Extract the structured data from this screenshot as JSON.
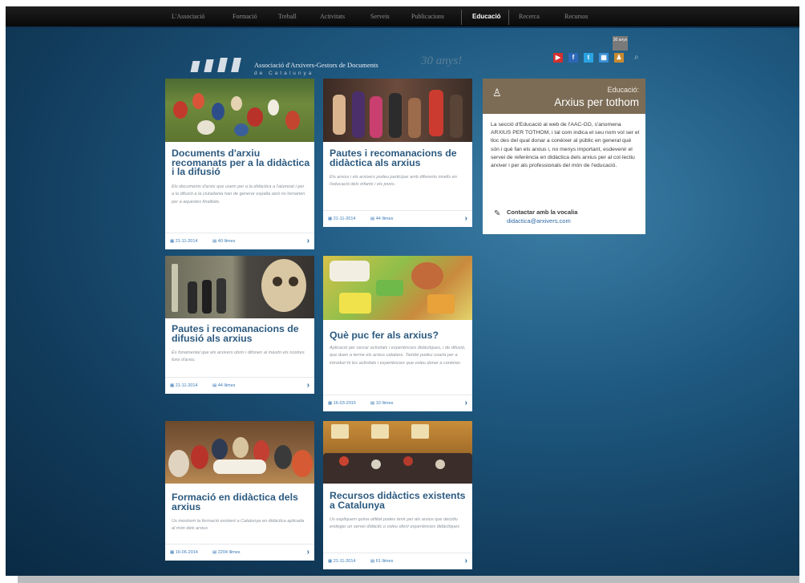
{
  "nav": {
    "items": [
      "L'Associació",
      "Formació",
      "Treball",
      "Activitats",
      "Serveis",
      "Publicacions",
      "Educació",
      "Recerca",
      "Recursos"
    ],
    "active": "Educació"
  },
  "header": {
    "org_name": "Associació d'Arxivers-Gestors de Documents",
    "org_region": "de Catalunya",
    "anniversary": "30 anys!",
    "badge": "30 anys"
  },
  "social": {
    "icons": [
      "youtube-icon",
      "facebook-icon",
      "twitter-icon",
      "calendar-icon",
      "user-icon",
      "search-icon"
    ],
    "colors": {
      "youtube": "#d32f2f",
      "facebook": "#2d68b8",
      "twitter": "#2aa3e0",
      "calendar": "#3a8fd6",
      "user": "#c88a2e"
    }
  },
  "cards": [
    {
      "title": "Documents d'arxiu recomanats per a la didàctica i la difusió",
      "desc": "Els documents d'arxiu que usem per a la didàctica a l'alumnat i per a la difusió a la ciutadania han de generar espalla això no tornarien per a aquestes finalitats.",
      "date": "21-11-2014",
      "reads": "40 llimes"
    },
    {
      "title": "Pautes i recomanacions de didàctica als arxius",
      "desc": "Els arxius i els arxivers podeu participar amb diferents nivells en l'educació dels infants i els joves.",
      "date": "21-11-2014",
      "reads": "44 llimes"
    },
    {
      "title": "Pautes i recomanacions de difusió als arxius",
      "desc": "És fonamental que els arxivers obrin i difonen al màxim els nostres fons d'arxiu.",
      "date": "21-11-2014",
      "reads": "44 llimes"
    },
    {
      "title": "Què puc fer als arxius?",
      "desc": "Aplicació per cercar activitats i experiències didàctiques, i de difusió, que duen a terme els arxius catalans. També podeu usarla per a introduir-hi les activitats i experiències que voleu donar a conèixer.",
      "date": "16-03-2015",
      "reads": "10 llimes"
    },
    {
      "title": "Formació en didàctica dels arxius",
      "desc": "Us mostrem la formació existent a Catalunya en didàctica aplicada al món dels arxius",
      "date": "16-06-2014",
      "reads": "2204 llimes"
    },
    {
      "title": "Recursos didàctics existents a Catalunya",
      "desc": "Us expliquem quina utilitat podeu tenir per als arxius que decidiu endegar un servei didàctic o voleu oferir experiències didàctiques",
      "date": "21-11-2014",
      "reads": "61 llimes"
    }
  ],
  "sidebar": {
    "kicker": "Educació:",
    "headline": "Arxius per tothom",
    "body": "La secció d'Educació al web de l'AAC-GD, s'anomena ARXIUS PER TOTHOM, i tal com indica el seu nom vol ser el lloc des del qual donar a conèixer al públic en general què són i què fan els arxius i, no menys important, esdevenir el servei de referència en didàctica dels arxius per al col·lectiu arxiver i per als professionals del món de l'educació.",
    "contact_label": "Contactar amb la vocalia",
    "contact_email": "didactica@arxivers.com",
    "head_color": "#7c6c55"
  }
}
